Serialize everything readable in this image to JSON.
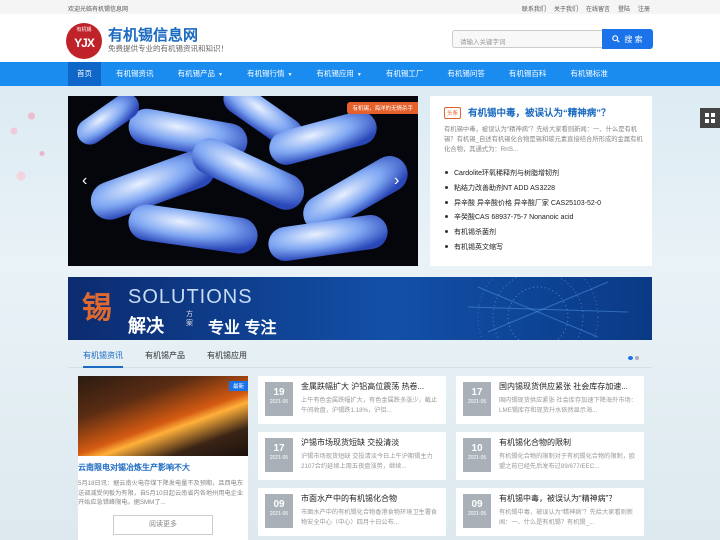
{
  "topbar": {
    "welcome": "欢迎光临有机锡信息网",
    "links": [
      "联系我们",
      "关于我们",
      "在线留言",
      "登陆",
      "注册"
    ]
  },
  "header": {
    "logo_text": "YJX",
    "logo_small": "有机锡",
    "site_name": "有机锡信息网",
    "slogan": "免费提供专业的有机锡资讯和知识！",
    "search_placeholder": "请输入关键字词",
    "search_button": "搜 索"
  },
  "nav": [
    {
      "label": "首页",
      "active": true,
      "caret": false
    },
    {
      "label": "有机锡资讯",
      "active": false,
      "caret": false
    },
    {
      "label": "有机锡产品",
      "active": false,
      "caret": true
    },
    {
      "label": "有机锡行情",
      "active": false,
      "caret": true
    },
    {
      "label": "有机锡应用",
      "active": false,
      "caret": true
    },
    {
      "label": "有机锡工厂",
      "active": false,
      "caret": false
    },
    {
      "label": "有机锡问答",
      "active": false,
      "caret": false
    },
    {
      "label": "有机锡百科",
      "active": false,
      "caret": false
    },
    {
      "label": "有机锡标准",
      "active": false,
      "caret": false
    }
  ],
  "banner": {
    "tag": "有机锡，海洋的无情杀手"
  },
  "hot": {
    "badge": "头条",
    "title": "有机锡中毒，被误认为“精神病”？",
    "desc": "有机锡中毒，被误认为“精神病”？先给大家看则新闻：一、什么是有机锡？有机锡_自述有机锡化合物是锡和碳元素直接结合所形成的金属有机化合物，其通式为：RnS...",
    "items": [
      "Cardolite环氧稀释剂与树脂增韧剂",
      "粘结力改善助剂NT ADD AS3228",
      "异辛酸 异辛酸价格 异辛酸厂家 CAS25103-52-0",
      "辛癸酸CAS 68937-75-7 Nonanoic acid",
      "有机锡杀菌剂",
      "有机锡英文缩写"
    ]
  },
  "solutions": {
    "char": "锡",
    "en": "SOLUTIONS",
    "cn": "解决",
    "fa": "方案",
    "zy": "专业 专注"
  },
  "tabs": [
    "有机锡资讯",
    "有机锡产品",
    "有机锡应用"
  ],
  "feature": {
    "badge": "最新",
    "title": "云南限电对锡冶炼生产影响不大",
    "desc": "5月18日讯：据云南火电存煤下降发电量不及预期，且西电东送调减受伺板为有限，自5月10日起云南省内各地州用电企业开始应急错峰限电。据SMM了...",
    "more": "阅读更多"
  },
  "cards": [
    {
      "day": "19",
      "ym": "2021-05",
      "title": "金属跌幅扩大 沪铝高位震荡 热卷...",
      "summary": "上午有色金属跌幅扩大，有色金属跌多涨少，截止午间收盘，沪锡跌1.18%，沪铝..."
    },
    {
      "day": "17",
      "ym": "2021-05",
      "title": "国内锡现货供应紧张 社会库存加速...",
      "summary": "国内锡现货供应紧张 社会库存加速下降海外市场：LME锡库存和现货升水依然显示海..."
    },
    {
      "day": "17",
      "ym": "2021-05",
      "title": "沪锡市场现货短缺 交投清淡",
      "summary": "沪锡市场现货短缺 交投清淡今日上午沪期锡主力2107合约延续上周五夜盘涨势，继续..."
    },
    {
      "day": "10",
      "ym": "2021-05",
      "title": "有机锡化合物的限制",
      "summary": "有机锡化合物的限制对于有机锡化合物的限制，欧盟之前已经先后发布过89/677/EEC..."
    },
    {
      "day": "09",
      "ym": "2021-05",
      "title": "市面水产中的有机锡化合物",
      "summary": "市面水产中的有机锡化合物香港食物环境卫生署食物安全中心（中心）四月十日公布..."
    },
    {
      "day": "09",
      "ym": "2021-05",
      "title": "有机锡中毒，被误认为“精神病”？",
      "summary": "有机锡中毒，被误认为“精神病”？先给大家看则新闻：一、什么是有机锡？有机锡_..."
    }
  ]
}
